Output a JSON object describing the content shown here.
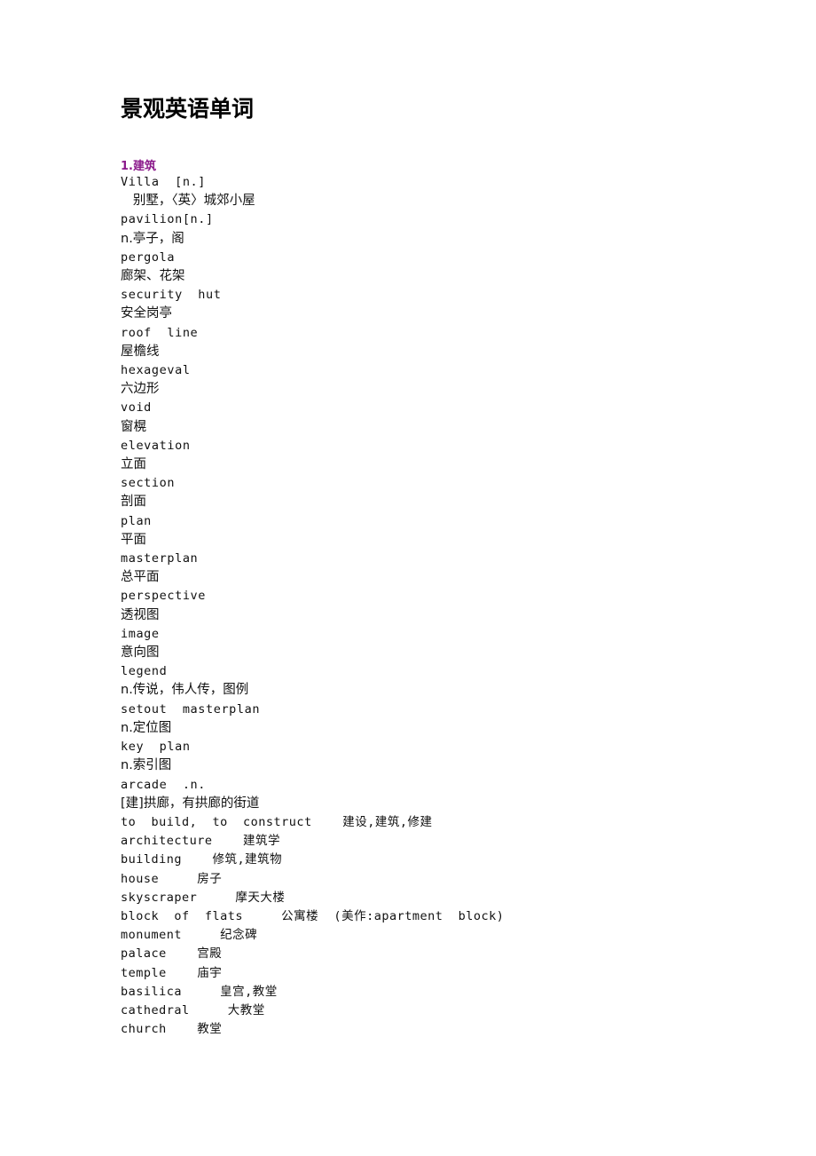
{
  "document": {
    "title": "景观英语单词",
    "accent_color": "#8b1a8b",
    "text_color": "#111111",
    "background_color": "#ffffff"
  },
  "sections": [
    {
      "heading": "1.建筑",
      "lines": [
        {
          "text": "Villa  [n.]",
          "script": "latin"
        },
        {
          "text": "   别墅，〈英〉城郊小屋",
          "script": "han"
        },
        {
          "text": "pavilion[n.]",
          "script": "latin"
        },
        {
          "text": "n.亭子，阁",
          "script": "han"
        },
        {
          "text": "pergola",
          "script": "latin"
        },
        {
          "text": "廊架、花架",
          "script": "han"
        },
        {
          "text": "security  hut",
          "script": "latin"
        },
        {
          "text": "安全岗亭",
          "script": "han"
        },
        {
          "text": "roof  line",
          "script": "latin"
        },
        {
          "text": "屋檐线",
          "script": "han"
        },
        {
          "text": "hexageval",
          "script": "latin"
        },
        {
          "text": "六边形",
          "script": "han"
        },
        {
          "text": "void",
          "script": "latin"
        },
        {
          "text": "窗榥",
          "script": "han"
        },
        {
          "text": "elevation",
          "script": "latin"
        },
        {
          "text": "立面",
          "script": "han"
        },
        {
          "text": "section",
          "script": "latin"
        },
        {
          "text": "剖面",
          "script": "han"
        },
        {
          "text": "plan",
          "script": "latin"
        },
        {
          "text": "平面",
          "script": "han"
        },
        {
          "text": "masterplan",
          "script": "latin"
        },
        {
          "text": "总平面",
          "script": "han"
        },
        {
          "text": "perspective",
          "script": "latin"
        },
        {
          "text": "透视图",
          "script": "han"
        },
        {
          "text": "image",
          "script": "latin"
        },
        {
          "text": "意向图",
          "script": "han"
        },
        {
          "text": "legend",
          "script": "latin"
        },
        {
          "text": "n.传说，伟人传，图例",
          "script": "han"
        },
        {
          "text": "setout  masterplan",
          "script": "latin"
        },
        {
          "text": "n.定位图",
          "script": "han"
        },
        {
          "text": "key  plan",
          "script": "latin"
        },
        {
          "text": "n.索引图",
          "script": "han"
        },
        {
          "text": "arcade  .n.",
          "script": "latin"
        },
        {
          "text": "[建]拱廊，有拱廊的街道",
          "script": "han"
        },
        {
          "text": "to  build,  to  construct    建设,建筑,修建",
          "script": "mixed"
        },
        {
          "text": "architecture    建筑学",
          "script": "mixed"
        },
        {
          "text": "building    修筑,建筑物",
          "script": "mixed"
        },
        {
          "text": "house     房子",
          "script": "mixed"
        },
        {
          "text": "skyscraper     摩天大楼",
          "script": "mixed"
        },
        {
          "text": "block  of  flats     公寓楼  (美作:apartment  block)",
          "script": "mixed"
        },
        {
          "text": "monument     纪念碑",
          "script": "mixed"
        },
        {
          "text": "palace    宫殿",
          "script": "mixed"
        },
        {
          "text": "temple    庙宇",
          "script": "mixed"
        },
        {
          "text": "basilica     皇宫,教堂",
          "script": "mixed"
        },
        {
          "text": "cathedral     大教堂",
          "script": "mixed"
        },
        {
          "text": "church    教堂",
          "script": "mixed"
        }
      ]
    }
  ]
}
